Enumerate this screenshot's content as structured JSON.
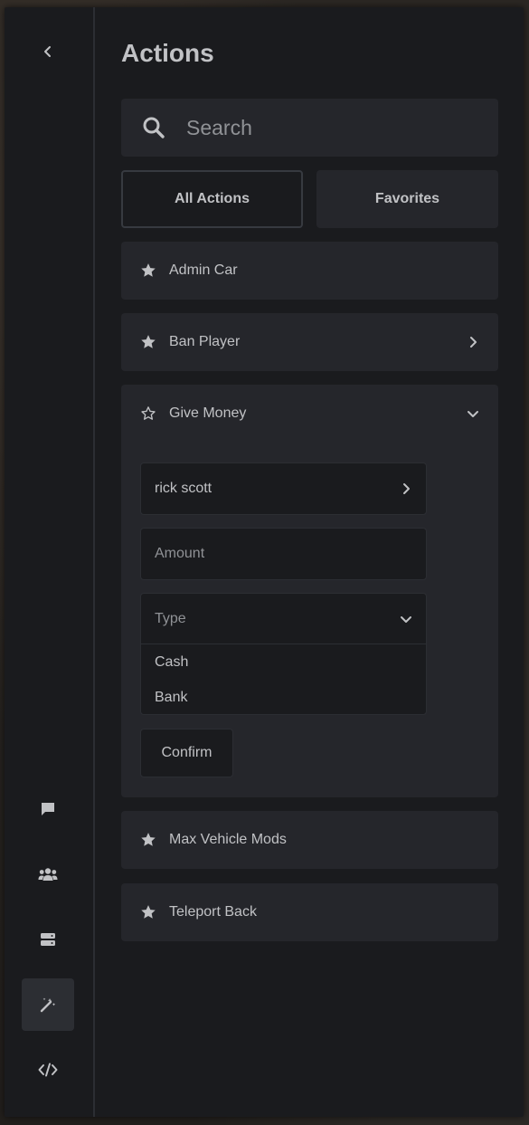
{
  "title": "Actions",
  "search": {
    "placeholder": "Search",
    "value": ""
  },
  "tabs": [
    {
      "label": "All Actions",
      "active": true
    },
    {
      "label": "Favorites",
      "active": false
    }
  ],
  "actions": [
    {
      "label": "Admin Car",
      "favorite": true,
      "indicator": "none"
    },
    {
      "label": "Ban Player",
      "favorite": true,
      "indicator": "chevron-right-icon"
    },
    {
      "label": "Give Money",
      "favorite": false,
      "indicator": "chevron-down-icon",
      "expanded": true
    },
    {
      "label": "Max Vehicle Mods",
      "favorite": true,
      "indicator": "none"
    },
    {
      "label": "Teleport Back",
      "favorite": true,
      "indicator": "none"
    }
  ],
  "give_money_form": {
    "player_value": "rick scott",
    "amount_placeholder": "Amount",
    "type_placeholder": "Type",
    "type_options": [
      "Cash",
      "Bank"
    ],
    "confirm_label": "Confirm"
  },
  "rail": [
    {
      "icon": "chevron-left-icon",
      "active": false
    },
    {
      "icon": "chat-icon",
      "active": false
    },
    {
      "icon": "users-icon",
      "active": false
    },
    {
      "icon": "server-icon",
      "active": false
    },
    {
      "icon": "magic-wand-icon",
      "active": true
    },
    {
      "icon": "code-icon",
      "active": false
    }
  ],
  "colors": {
    "panel": "#1a1b1e",
    "card": "#25262b",
    "border": "#373a40",
    "text": "#c1c2c5",
    "placeholder": "#909296"
  }
}
